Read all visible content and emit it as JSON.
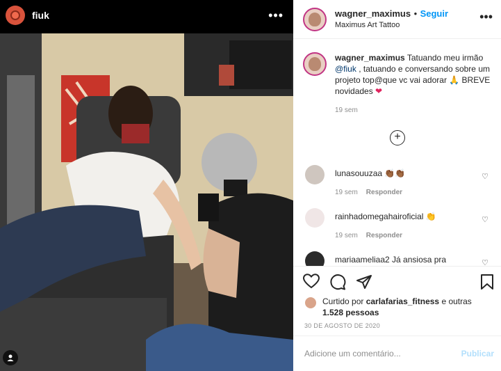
{
  "media": {
    "username": "fiuk"
  },
  "post_header": {
    "username": "wagner_maximus",
    "separator": "•",
    "follow_label": "Seguir",
    "location": "Maximus Art Tattoo"
  },
  "caption": {
    "username": "wagner_maximus",
    "text_before": "Tatuando meu irmão ",
    "mention": "@fiuk",
    "text_after": " , tatuando e conversando sobre um projeto top@que vc vai adorar 🙏 BREVE novidades ",
    "heart": "❤",
    "time": "19 sem"
  },
  "comments": [
    {
      "username": "lunasouuzaa",
      "text": "👏🏾👏🏾",
      "time": "19 sem",
      "reply_label": "Responder"
    },
    {
      "username": "rainhadomegahairoficial",
      "text": "👏",
      "time": "19 sem",
      "reply_label": "Responder"
    },
    {
      "username": "mariaameliaa2",
      "text": "Já ansiosa pra",
      "time": "",
      "reply_label": ""
    }
  ],
  "likes": {
    "prefix": "Curtido por ",
    "user": "carlafarias_fitness",
    "middle": " e outras ",
    "count": "1.528 pessoas"
  },
  "date": "30 DE AGOSTO DE 2020",
  "comment_box": {
    "placeholder": "Adicione um comentário...",
    "publish_label": "Publicar"
  },
  "icons": [
    "kebab-icon",
    "heart-icon",
    "comment-icon",
    "share-icon",
    "bookmark-icon",
    "add-circle-icon",
    "user-tag-icon"
  ]
}
